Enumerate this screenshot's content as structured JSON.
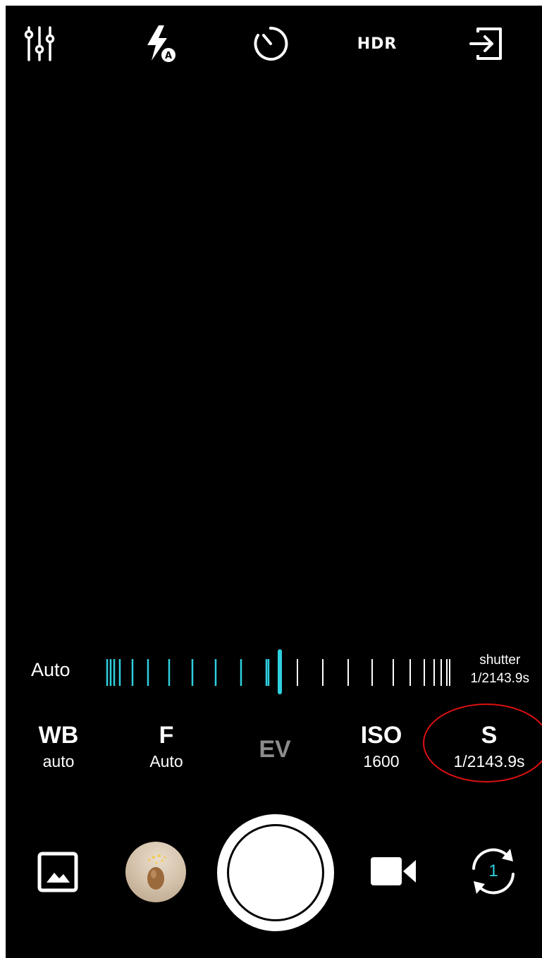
{
  "topbar": {
    "settings_icon": "sliders-icon",
    "flash_icon": "flash-auto-icon",
    "timer_icon": "timer-icon",
    "hdr_label": "HDR",
    "exit_icon": "exit-icon"
  },
  "slider": {
    "mode_label": "Auto",
    "readout_name": "shutter",
    "readout_value": "1/2143.9s",
    "accent_color": "#2fd0e0"
  },
  "modes": [
    {
      "title": "WB",
      "value": "auto"
    },
    {
      "title": "F",
      "value": "Auto"
    },
    {
      "title": "EV",
      "value": ""
    },
    {
      "title": "ISO",
      "value": "1600"
    },
    {
      "title": "S",
      "value": "1/2143.9s"
    }
  ],
  "bottombar": {
    "gallery_icon": "gallery-icon",
    "video_icon": "video-camera-icon",
    "switch_camera_icon": "switch-camera-icon",
    "camera_index": "1"
  },
  "colors": {
    "background": "#000000",
    "foreground": "#ffffff",
    "accent": "#2fd0e0",
    "disabled": "#8c8c8c",
    "annotation": "#e01010"
  }
}
